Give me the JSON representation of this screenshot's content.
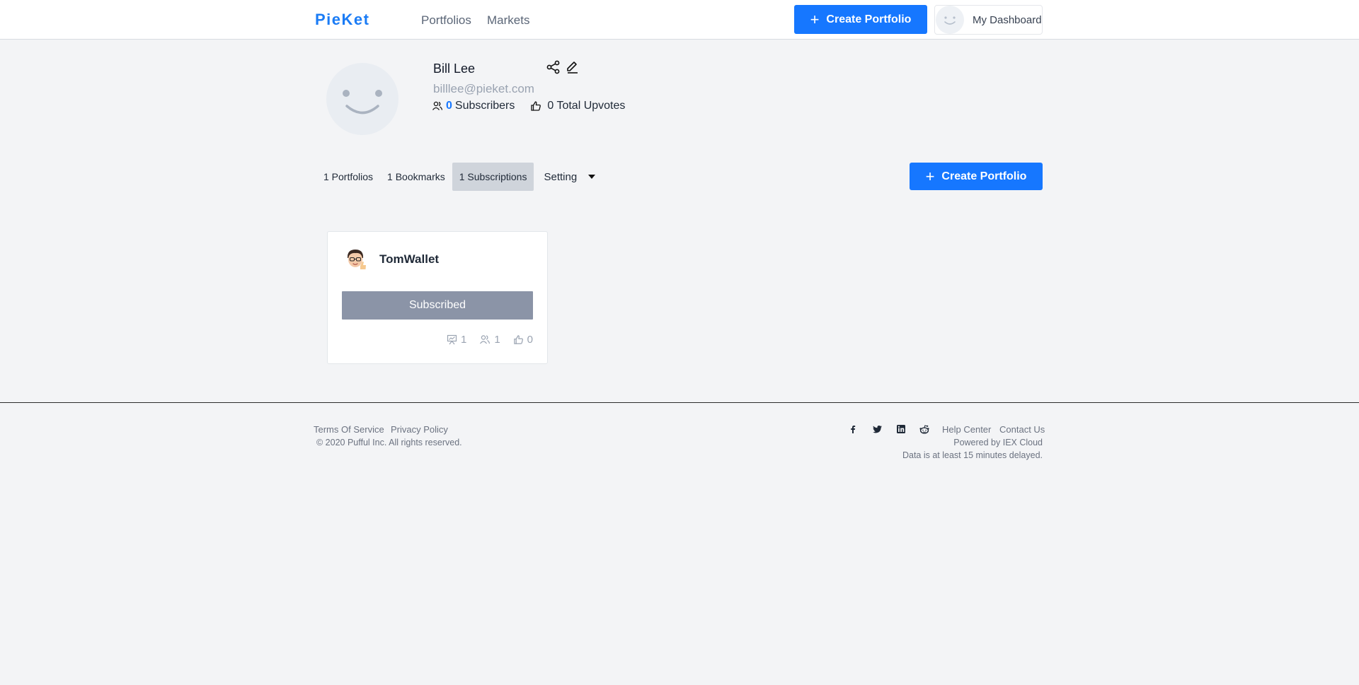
{
  "brand": {
    "name": "PieKet"
  },
  "nav": {
    "portfolios": "Portfolios",
    "markets": "Markets"
  },
  "header": {
    "create_portfolio": "Create Portfolio",
    "dashboard": "My Dashboard"
  },
  "profile": {
    "name": "Bill Lee",
    "email": "billlee@pieket.com",
    "subscribers_count": "0",
    "subscribers_label": "Subscribers",
    "upvotes": "0 Total Upvotes"
  },
  "tabs": {
    "portfolios": "1 Portfolios",
    "bookmarks": "1 Bookmarks",
    "subscriptions": "1 Subscriptions",
    "setting": "Setting"
  },
  "create_portfolio_main": "Create Portfolio",
  "subscription_card": {
    "title": "TomWallet",
    "button": "Subscribed",
    "portfolios": "1",
    "subscribers": "1",
    "upvotes": "0"
  },
  "footer": {
    "terms": "Terms Of Service",
    "privacy": "Privacy Policy",
    "copyright": "© 2020 Pufful Inc. All rights reserved.",
    "help": "Help Center",
    "contact": "Contact Us",
    "powered": "Powered by IEX Cloud",
    "delay": "Data is at least 15 minutes delayed."
  },
  "colors": {
    "accent": "#1677ff",
    "subscribed_button": "#8b94a7",
    "page_bg": "#f3f4f6"
  },
  "icons": [
    "plus-icon",
    "share-icon",
    "edit-icon",
    "users-icon",
    "thumbs-up-icon",
    "chart-icon",
    "facebook-icon",
    "twitter-icon",
    "linkedin-icon",
    "reddit-icon",
    "caret-down-icon"
  ]
}
